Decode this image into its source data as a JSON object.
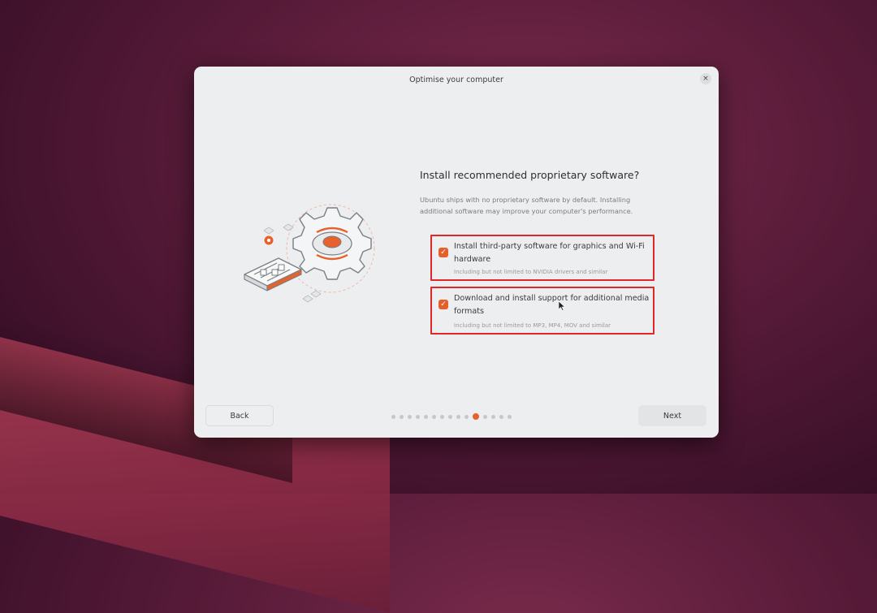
{
  "window": {
    "title": "Optimise your computer",
    "close_icon": "×"
  },
  "main": {
    "heading": "Install recommended proprietary software?",
    "description": "Ubuntu ships with no proprietary software by default. Installing additional software may improve your computer's performance."
  },
  "options": [
    {
      "label": "Install third-party software for graphics and Wi-Fi hardware",
      "sublabel": "Including but not limited to NVIDIA drivers and similar",
      "checked": true
    },
    {
      "label": "Download and install support for additional media formats",
      "sublabel": "Including but not limited to MP3, MP4, MOV and similar",
      "checked": true
    }
  ],
  "footer": {
    "back_label": "Back",
    "next_label": "Next",
    "total_steps": 15,
    "current_step": 11
  },
  "colors": {
    "accent": "#e6612b",
    "highlight": "#e0282b",
    "dialog_bg": "#eceef0"
  },
  "icons": {
    "checkbox": "check-icon",
    "close": "close-icon",
    "illustration": "gear-settings-illustration"
  }
}
